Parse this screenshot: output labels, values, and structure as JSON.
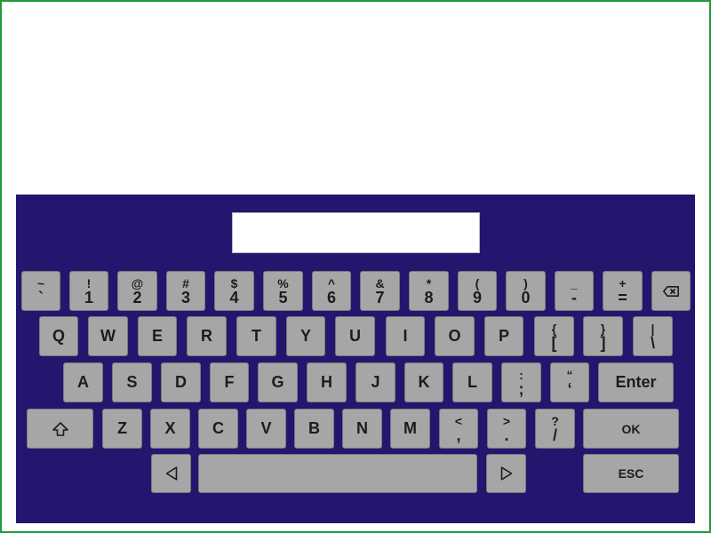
{
  "display": {
    "value": ""
  },
  "keys": {
    "tilde": {
      "shift": "~",
      "base": "`"
    },
    "k1": {
      "shift": "!",
      "base": "1"
    },
    "k2": {
      "shift": "@",
      "base": "2"
    },
    "k3": {
      "shift": "#",
      "base": "3"
    },
    "k4": {
      "shift": "$",
      "base": "4"
    },
    "k5": {
      "shift": "%",
      "base": "5"
    },
    "k6": {
      "shift": "^",
      "base": "6"
    },
    "k7": {
      "shift": "&",
      "base": "7"
    },
    "k8": {
      "shift": "*",
      "base": "8"
    },
    "k9": {
      "shift": "(",
      "base": "9"
    },
    "k0": {
      "shift": ")",
      "base": "0"
    },
    "minus": {
      "shift": "_",
      "base": "-"
    },
    "equals": {
      "shift": "+",
      "base": "="
    },
    "backspace": {
      "icon": "backspace-icon"
    },
    "q": "Q",
    "w": "W",
    "e": "E",
    "r": "R",
    "t": "T",
    "y": "Y",
    "u": "U",
    "i": "I",
    "o": "O",
    "p": "P",
    "lbrace": {
      "shift": "{",
      "base": "["
    },
    "rbrace": {
      "shift": "}",
      "base": "]"
    },
    "pipe": {
      "shift": "|",
      "base": "\\"
    },
    "a": "A",
    "s": "S",
    "d": "D",
    "f": "F",
    "g": "G",
    "h": "H",
    "j": "J",
    "k": "K",
    "l": "L",
    "semicolon": {
      "shift": ":",
      "base": ";"
    },
    "quote": {
      "shift": "“",
      "base": "‘"
    },
    "enter": "Enter",
    "shift": {
      "icon": "shift-arrow-icon"
    },
    "z": "Z",
    "x": "X",
    "c": "C",
    "v": "V",
    "b": "B",
    "n": "N",
    "m": "M",
    "comma": {
      "shift": "<",
      "base": ","
    },
    "period": {
      "shift": ">",
      "base": "."
    },
    "slash": {
      "shift": "?",
      "base": "/"
    },
    "ok": "OK",
    "left": {
      "icon": "left-triangle-icon"
    },
    "space": {
      "label": ""
    },
    "right": {
      "icon": "right-triangle-icon"
    },
    "esc": "ESC"
  },
  "colors": {
    "panel": "#24166e",
    "key": "#a6a6a6",
    "frame": "#1f9a3c"
  }
}
